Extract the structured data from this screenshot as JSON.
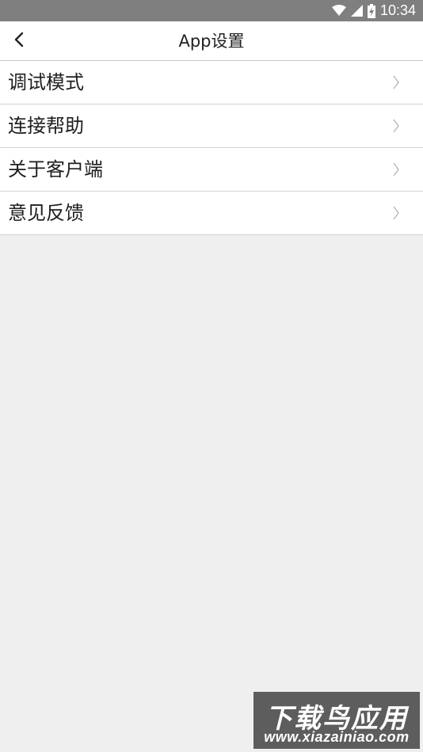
{
  "status_bar": {
    "time": "10:34",
    "icons": [
      "wifi-icon",
      "cell-signal-icon",
      "battery-charging-icon"
    ]
  },
  "header": {
    "title": "App设置",
    "back_icon": "back-chevron-icon"
  },
  "menu": {
    "items": [
      {
        "label": "调试模式"
      },
      {
        "label": "连接帮助"
      },
      {
        "label": "关于客户端"
      },
      {
        "label": "意见反馈"
      }
    ]
  },
  "watermark": {
    "logo": "下载鸟应用",
    "url": "www.xiazainiao.com"
  },
  "colors": {
    "status_bar": "#7f7f7f",
    "background": "#efefef",
    "row_background": "#ffffff",
    "divider": "#d2d2d2"
  }
}
